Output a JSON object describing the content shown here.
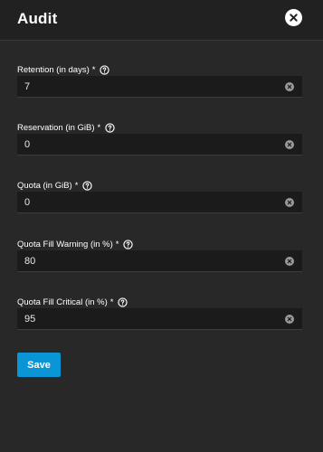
{
  "dialog": {
    "title": "Audit",
    "close_icon": "close-icon"
  },
  "fields": [
    {
      "label": "Retention (in days)",
      "required": "*",
      "value": "7",
      "help_icon": "help-circle-icon",
      "clear_icon": "clear-icon"
    },
    {
      "label": "Reservation (in GiB)",
      "required": "*",
      "value": "0",
      "help_icon": "help-circle-icon",
      "clear_icon": "clear-icon"
    },
    {
      "label": "Quota (in GiB)",
      "required": "*",
      "value": "0",
      "help_icon": "help-circle-icon",
      "clear_icon": "clear-icon"
    },
    {
      "label": "Quota Fill Warning (in %)",
      "required": "*",
      "value": "80",
      "help_icon": "help-circle-icon",
      "clear_icon": "clear-icon"
    },
    {
      "label": "Quota Fill Critical (in %)",
      "required": "*",
      "value": "95",
      "help_icon": "help-circle-icon",
      "clear_icon": "clear-icon"
    }
  ],
  "actions": {
    "save_label": "Save"
  },
  "colors": {
    "background": "#282828",
    "header_background": "#212121",
    "input_background": "#1b1b1b",
    "accent": "#0a95d6",
    "text": "#ffffff"
  }
}
